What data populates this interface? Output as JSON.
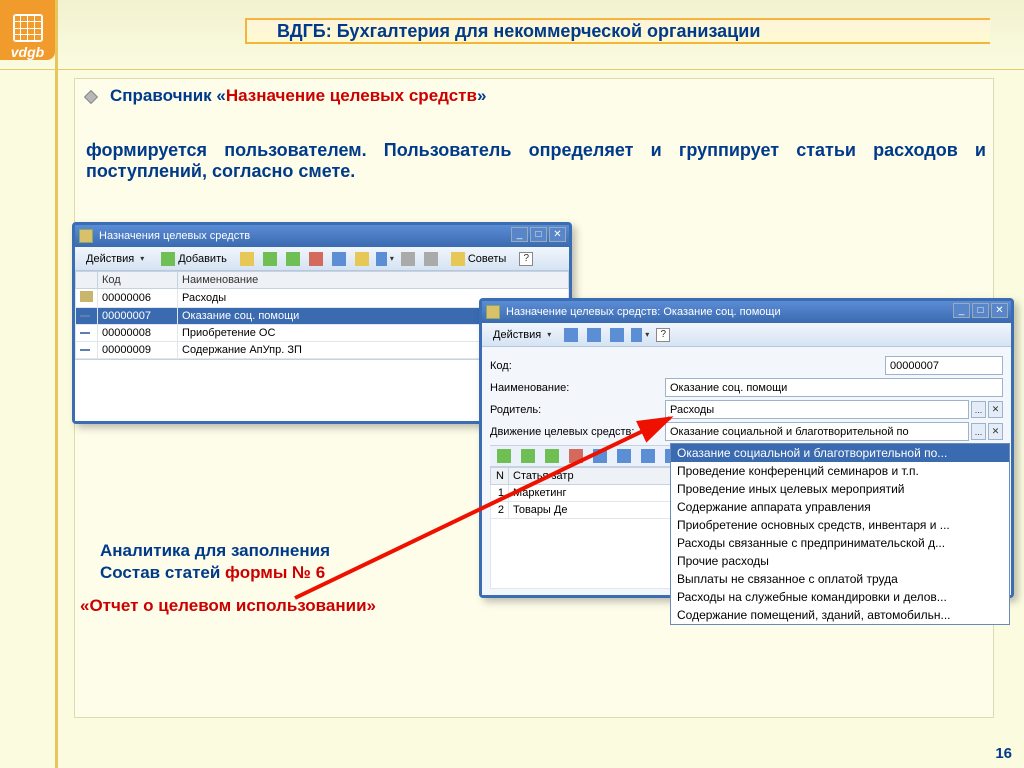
{
  "app_title": "ВДГБ: Бухгалтерия для некоммерческой организации",
  "logo_text": "vdgb",
  "heading_prefix": "Справочник «",
  "heading_red": "Назначение целевых средств",
  "heading_suffix": "»",
  "body": "формируется пользователем. Пользователь определяет и группирует статьи расходов и поступлений, согласно смете.",
  "win1": {
    "title": "Назначения целевых средств",
    "actions": "Действия",
    "add": "Добавить",
    "advice": "Советы",
    "cols": {
      "c1": "",
      "c2": "Код",
      "c3": "Наименование"
    },
    "rows": [
      {
        "code": "00000006",
        "name": "Расходы",
        "folder": true
      },
      {
        "code": "00000007",
        "name": "Оказание соц. помощи",
        "folder": false,
        "selected": true
      },
      {
        "code": "00000008",
        "name": "Приобретение ОС",
        "folder": false
      },
      {
        "code": "00000009",
        "name": "Содержание АпУпр. ЗП",
        "folder": false
      }
    ]
  },
  "win2": {
    "title": "Назначение целевых средств: Оказание соц. помощи",
    "actions": "Действия",
    "labels": {
      "code": "Код:",
      "name": "Наименование:",
      "parent": "Родитель:",
      "movement": "Движение целевых средств:"
    },
    "values": {
      "code": "00000007",
      "name": "Оказание соц. помощи",
      "parent": "Расходы",
      "movement": "Оказание социальной и благотворительной по"
    },
    "sub_cols": {
      "n": "N",
      "item": "Статья затр"
    },
    "sub_rows": [
      {
        "n": "1",
        "item": "Маркетинг"
      },
      {
        "n": "2",
        "item": "Товары Де"
      }
    ]
  },
  "dropdown": [
    "Оказание социальной и благотворительной по...",
    "Проведение конференций семинаров и т.п.",
    "Проведение иных целевых мероприятий",
    "Содержание аппарата управления",
    "Приобретение основных средств, инвентаря и ...",
    "Расходы связанные с предпринимательской д...",
    "Прочие расходы",
    "Выплаты не связанное с оплатой труда",
    "Расходы на служебные командировки и делов...",
    "Содержание помещений, зданий, автомобильн..."
  ],
  "bottom": {
    "line1": "Аналитика для заполнения",
    "line2a": "Состав статей",
    "line2b": "формы № 6",
    "overlap_pre": "«Отчет о целевом исп",
    "overlap_red": "ользовании»"
  },
  "page_num": "16"
}
